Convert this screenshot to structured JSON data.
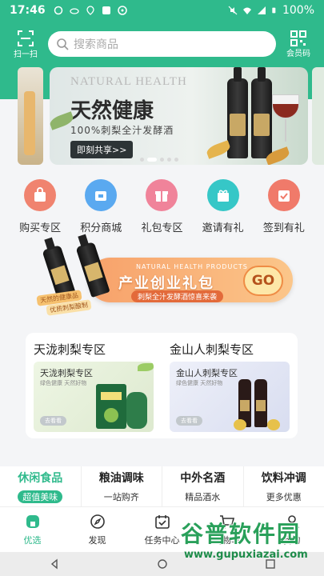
{
  "status_bar": {
    "time": "17:46",
    "battery": "100%"
  },
  "header": {
    "scan_label": "扫一扫",
    "search_placeholder": "搜索商品",
    "member_label": "会员码"
  },
  "banner": {
    "en_title": "NATURAL HEALTH",
    "cn_title": "天然健康",
    "subtitle": "100%刺梨全汁发酵酒",
    "share_button": "即刻共享>>"
  },
  "categories": [
    {
      "label": "购买专区",
      "icon": "shopping-bag-icon",
      "color": "#f0836f"
    },
    {
      "label": "积分商城",
      "icon": "points-mall-icon",
      "color": "#5aa9f0"
    },
    {
      "label": "礼包专区",
      "icon": "gift-box-icon",
      "color": "#f0839a"
    },
    {
      "label": "邀请有礼",
      "icon": "invite-gift-icon",
      "color": "#36c7c7"
    },
    {
      "label": "签到有礼",
      "icon": "calendar-checkin-icon",
      "color": "#f07a6a"
    }
  ],
  "promo": {
    "en_text": "NATURAL HEALTH PRODUCTS",
    "title": "产业创业礼包",
    "subtitle": "刺梨全汁发酵酒惊喜来袭",
    "go_label": "GO",
    "tag1": "天然的健康品",
    "tag2": "优质刺梨酿制"
  },
  "zones": [
    {
      "title": "天泷刺梨专区",
      "card_title": "天泷刺梨专区",
      "card_sub": "绿色健康 天然好物",
      "card_go": "去看看",
      "color": "#e7f2dd"
    },
    {
      "title": "金山人刺梨专区",
      "card_title": "金山人刺梨专区",
      "card_sub": "绿色健康 天然好物",
      "card_go": "去看看",
      "color": "#e2e6f4"
    }
  ],
  "bottom_categories": [
    {
      "title": "休闲食品",
      "sub": "超值美味",
      "active": true
    },
    {
      "title": "粮油调味",
      "sub": "一站购齐",
      "active": false
    },
    {
      "title": "中外名酒",
      "sub": "精品酒水",
      "active": false
    },
    {
      "title": "饮料冲调",
      "sub": "更多优惠",
      "active": false
    }
  ],
  "tabs": [
    {
      "label": "优选",
      "icon": "home-icon",
      "active": true
    },
    {
      "label": "发现",
      "icon": "compass-icon",
      "active": false
    },
    {
      "label": "任务中心",
      "icon": "task-calendar-icon",
      "active": false
    },
    {
      "label": "购物车",
      "icon": "cart-icon",
      "active": false
    },
    {
      "label": "我的",
      "icon": "user-icon",
      "active": false
    }
  ],
  "watermark": {
    "cn": "谷普软件园",
    "url": "www.gupuxiazai.com"
  }
}
